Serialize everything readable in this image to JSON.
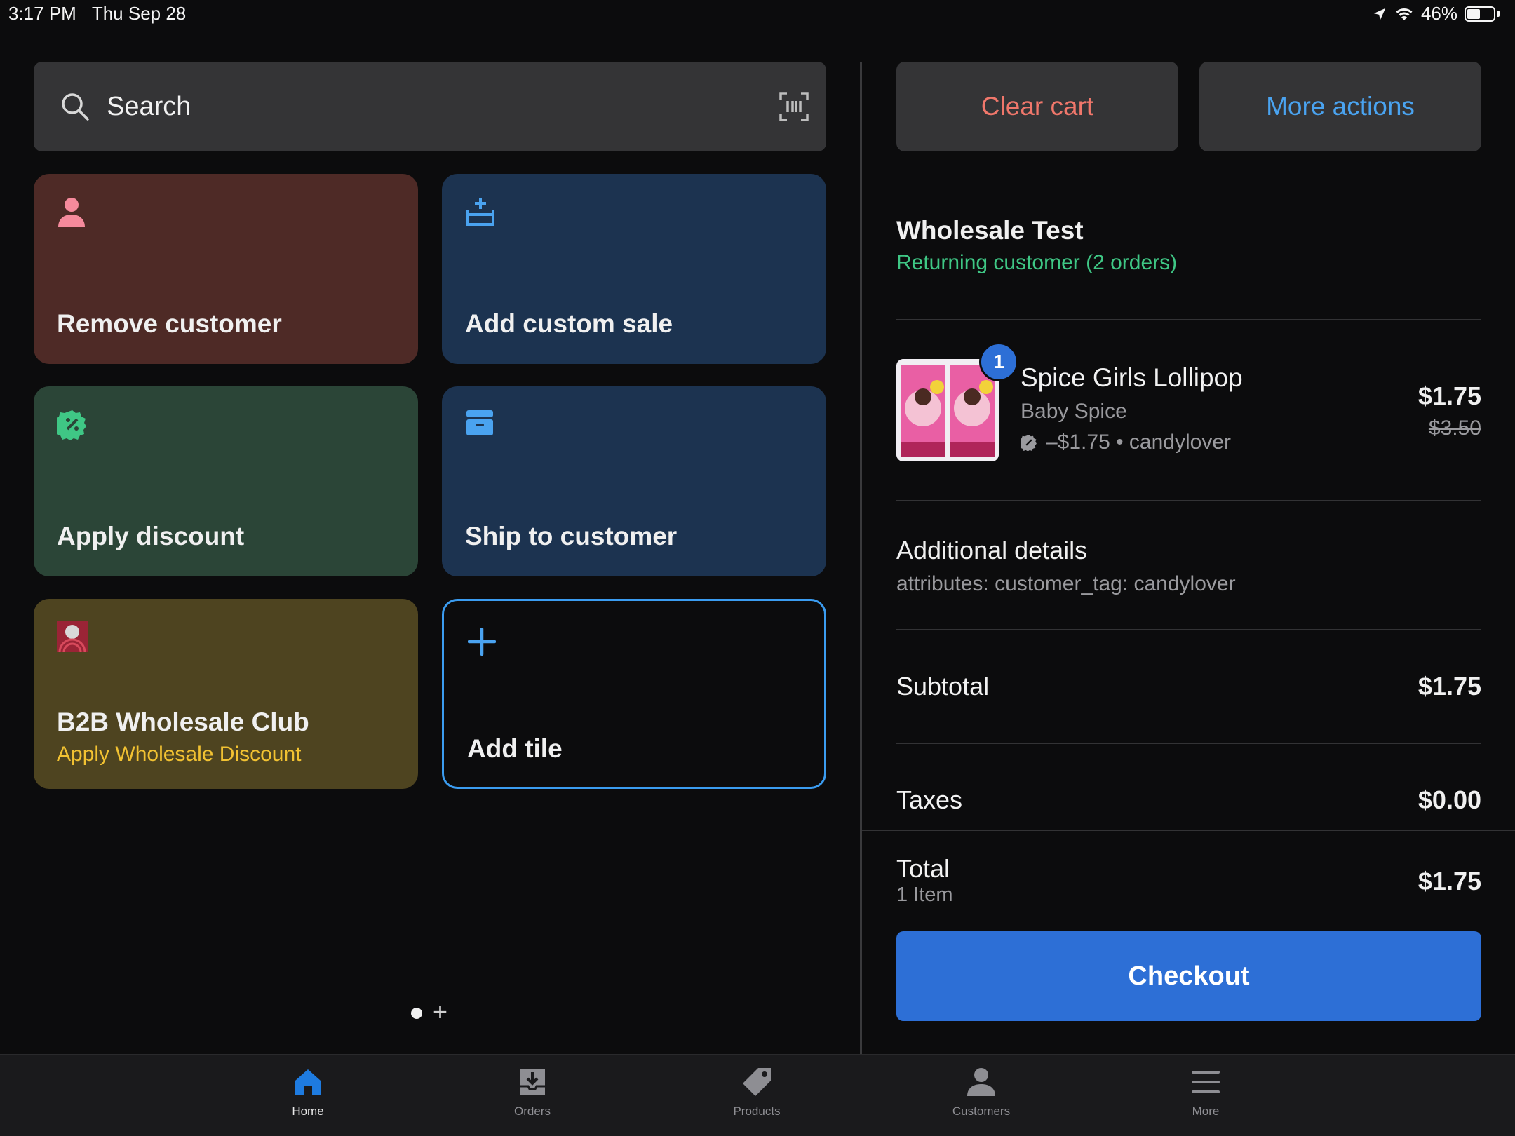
{
  "status_bar": {
    "time": "3:17 PM",
    "date": "Thu Sep 28",
    "battery": "46%"
  },
  "search": {
    "placeholder": "Search"
  },
  "tiles": [
    {
      "label": "Remove customer",
      "icon": "person-icon",
      "color": "#4e2a26"
    },
    {
      "label": "Add custom sale",
      "icon": "basket-add-icon",
      "color": "#1c3350"
    },
    {
      "label": "Apply discount",
      "icon": "discount-badge-icon",
      "color": "#2b4537"
    },
    {
      "label": "Ship to customer",
      "icon": "box-icon",
      "color": "#1c3350"
    },
    {
      "label": "B2B Wholesale Club",
      "sublabel": "Apply Wholesale Discount",
      "icon": "app-logo-icon",
      "color": "#4e4420"
    },
    {
      "label": "Add tile",
      "icon": "plus-icon",
      "color": "#0c0c0d"
    }
  ],
  "pager": {
    "add_symbol": "+"
  },
  "cart": {
    "clear_label": "Clear cart",
    "more_label": "More actions",
    "customer": {
      "name": "Wholesale Test",
      "status": "Returning customer (2 orders)"
    },
    "item": {
      "quantity": "1",
      "name": "Spice Girls Lollipop",
      "variant": "Baby Spice",
      "discount": "–$1.75 • candylover",
      "price": "$1.75",
      "original_price": "$3.50"
    },
    "details": {
      "title": "Additional details",
      "text": "attributes: customer_tag: candylover"
    },
    "subtotal": {
      "label": "Subtotal",
      "value": "$1.75"
    },
    "taxes": {
      "label": "Taxes",
      "value": "$0.00"
    },
    "total": {
      "label": "Total",
      "count": "1 Item",
      "value": "$1.75"
    },
    "checkout_label": "Checkout"
  },
  "nav": [
    {
      "label": "Home",
      "icon": "home-icon",
      "active": true
    },
    {
      "label": "Orders",
      "icon": "orders-icon"
    },
    {
      "label": "Products",
      "icon": "tag-icon"
    },
    {
      "label": "Customers",
      "icon": "person-icon"
    },
    {
      "label": "More",
      "icon": "menu-icon"
    }
  ],
  "colors": {
    "accent_blue": "#4aa3f0",
    "clear_red": "#f0776b",
    "returning_green": "#3fc785",
    "wholesale_yellow": "#f2c232",
    "checkout_blue": "#2d6fd6"
  }
}
